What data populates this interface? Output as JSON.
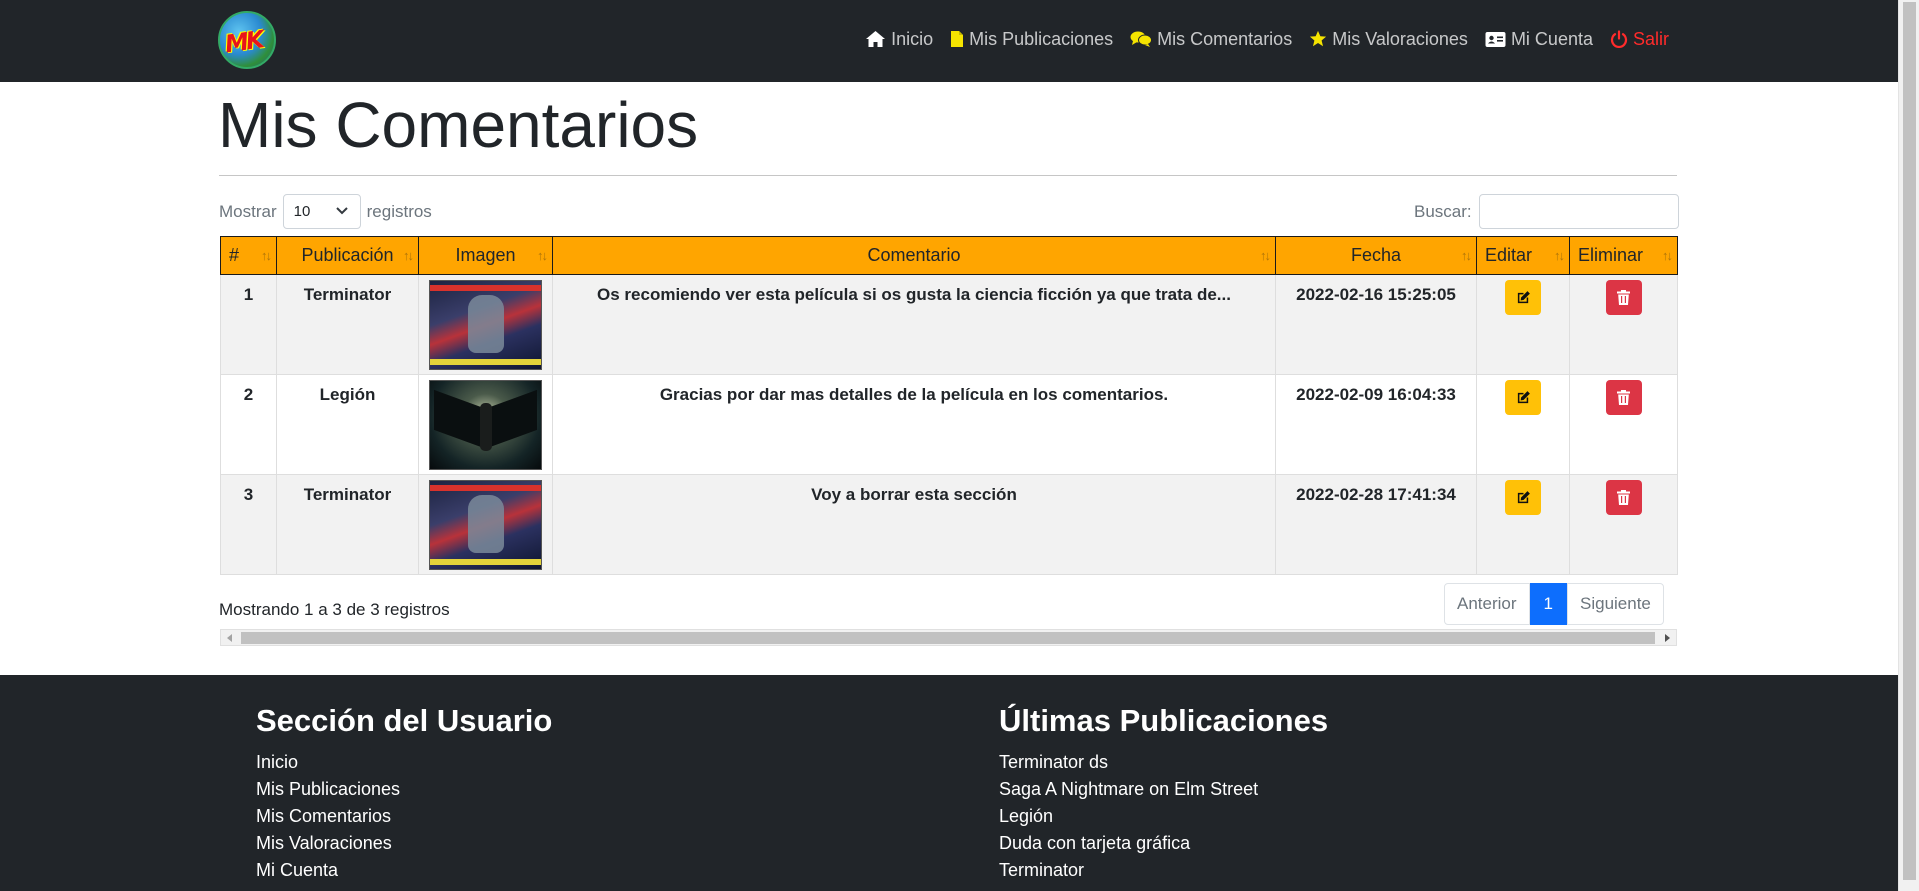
{
  "nav": {
    "items": [
      {
        "label": "Inicio",
        "icon": "home-icon"
      },
      {
        "label": "Mis Publicaciones",
        "icon": "file-icon"
      },
      {
        "label": "Mis Comentarios",
        "icon": "comments-icon"
      },
      {
        "label": "Mis Valoraciones",
        "icon": "star-icon"
      },
      {
        "label": "Mi Cuenta",
        "icon": "id-card-icon"
      },
      {
        "label": "Salir",
        "icon": "power-icon"
      }
    ],
    "colors": {
      "background": "#212529",
      "exit": "#ff2b2b",
      "publicaciones_icon": "#f5e400",
      "star_icon": "#f5e400"
    }
  },
  "logo": {
    "text": "MK"
  },
  "page": {
    "title": "Mis Comentarios"
  },
  "table_controls": {
    "show_label_before": "Mostrar",
    "show_value": "10",
    "show_label_after": "registros",
    "search_label": "Buscar:"
  },
  "table": {
    "header_color": "#ffa500",
    "columns": [
      "#",
      "Publicación",
      "Imagen",
      "Comentario",
      "Fecha",
      "Editar",
      "Eliminar"
    ],
    "sort_indicator": "↑↓",
    "rows": [
      {
        "num": "1",
        "publicacion": "Terminator",
        "imagen": "terminator-poster",
        "comentario": "Os recomiendo ver esta película si os gusta la ciencia ficción ya que trata de...",
        "fecha": "2022-02-16 15:25:05"
      },
      {
        "num": "2",
        "publicacion": "Legión",
        "imagen": "legion-poster",
        "comentario": "Gracias por dar mas detalles de la película en los comentarios.",
        "fecha": "2022-02-09 16:04:33"
      },
      {
        "num": "3",
        "publicacion": "Terminator",
        "imagen": "terminator-poster",
        "comentario": "Voy a borrar esta sección",
        "fecha": "2022-02-28 17:41:34"
      }
    ],
    "edit_color": "#ffc107",
    "delete_color": "#dc3545"
  },
  "table_footer": {
    "info": "Mostrando 1 a 3 de 3 registros",
    "prev": "Anterior",
    "current_page": "1",
    "next": "Siguiente",
    "page_color": "#0d6efd"
  },
  "footer": {
    "user_section": {
      "title": "Sección del Usuario",
      "links": [
        "Inicio",
        "Mis Publicaciones",
        "Mis Comentarios",
        "Mis Valoraciones",
        "Mi Cuenta"
      ]
    },
    "latest": {
      "title": "Últimas Publicaciones",
      "links": [
        "Terminator ds",
        "Saga A Nightmare on Elm Street",
        "Legión",
        "Duda con tarjeta gráfica",
        "Terminator"
      ]
    }
  }
}
